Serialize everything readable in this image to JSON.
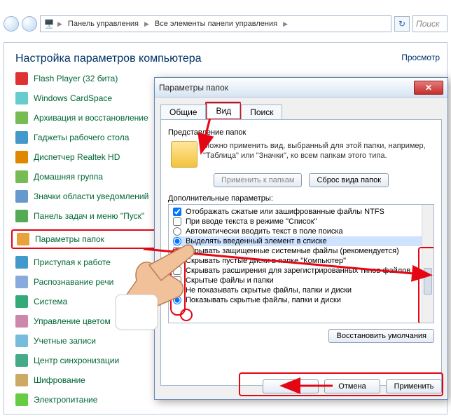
{
  "toolbar": {
    "breadcrumb": [
      "Панель управления",
      "Все элементы панели управления"
    ],
    "search_placeholder": "Поиск"
  },
  "cp": {
    "heading": "Настройка параметров компьютера",
    "view_label": "Просмотр",
    "items": [
      "Flash Player (32 бита)",
      "Windows CardSpace",
      "Архивация и восстановление",
      "Гаджеты рабочего стола",
      "Диспетчер Realtek HD",
      "Домашняя группа",
      "Значки области уведомлений",
      "Панель задач и меню \"Пуск\"",
      "Параметры папок",
      "Приступая к работе",
      "Распознавание речи",
      "Система",
      "Управление цветом",
      "Учетные записи",
      "Центр синхронизации",
      "Шифрование",
      "Электропитание"
    ],
    "highlight_index": 8
  },
  "dialog": {
    "title": "Параметры папок",
    "tabs": [
      "Общие",
      "Вид",
      "Поиск"
    ],
    "active_tab": 1,
    "section1_title": "Представление папок",
    "section1_desc": "Можно применить вид, выбранный для этой папки, например, \"Таблица\" или \"Значки\", ко всем папкам этого типа.",
    "apply_to_folders": "Применить к папкам",
    "reset_folders": "Сброс вида папок",
    "adv_label": "Дополнительные параметры:",
    "adv_items": [
      {
        "type": "check",
        "checked": true,
        "indent": 0,
        "label": "Отображать сжатые или зашифрованные файлы NTFS"
      },
      {
        "type": "check",
        "checked": false,
        "indent": 0,
        "label": "При вводе текста в режиме \"Список\""
      },
      {
        "type": "radio",
        "checked": false,
        "indent": 1,
        "label": "Автоматически вводить текст в поле поиска"
      },
      {
        "type": "radio",
        "checked": true,
        "indent": 1,
        "label": "Выделять введенный элемент в списке",
        "selected": true
      },
      {
        "type": "check",
        "checked": false,
        "indent": 0,
        "label": "Скрывать защищенные системные файлы (рекомендуется)"
      },
      {
        "type": "check",
        "checked": true,
        "indent": 0,
        "label": "Скрывать пустые диски в папке \"Компьютер\""
      },
      {
        "type": "check",
        "checked": false,
        "indent": 0,
        "label": "Скрывать расширения для зарегистрированных типов файлов"
      },
      {
        "type": "check",
        "checked": false,
        "indent": 0,
        "label": "Скрытые файлы и папки"
      },
      {
        "type": "radio",
        "checked": false,
        "indent": 1,
        "label": "Не показывать скрытые файлы, папки и диски"
      },
      {
        "type": "radio",
        "checked": true,
        "indent": 1,
        "label": "Показывать скрытые файлы, папки и диски"
      }
    ],
    "restore_defaults": "Восстановить умолчания",
    "ok": "OK",
    "cancel": "Отмена",
    "apply": "Применить"
  }
}
